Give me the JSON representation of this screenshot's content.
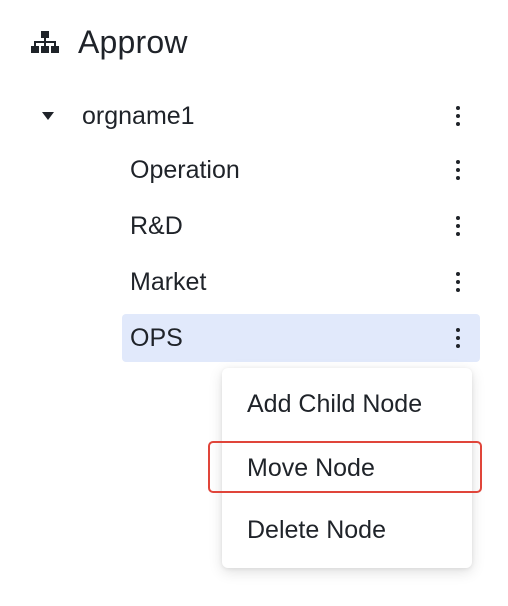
{
  "header": {
    "title": "Approw",
    "icon": "org-chart-icon"
  },
  "tree": {
    "root": {
      "label": "orgname1",
      "expanded": true
    },
    "children": [
      {
        "label": "Operation"
      },
      {
        "label": "R&D"
      },
      {
        "label": "Market"
      },
      {
        "label": "OPS",
        "selected": true
      }
    ]
  },
  "context_menu": {
    "items": [
      {
        "label": "Add Child Node"
      },
      {
        "label": "Move Node",
        "highlighted": true
      },
      {
        "label": "Delete Node"
      }
    ]
  },
  "colors": {
    "text": "#1f2329",
    "selected_bg": "#e1e9fb",
    "highlight_border": "#e0453a"
  }
}
